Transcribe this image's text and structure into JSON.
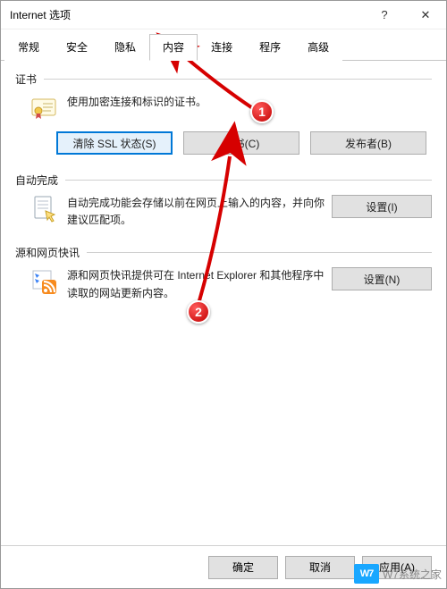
{
  "window": {
    "title": "Internet 选项",
    "help": "?",
    "close": "✕"
  },
  "tabs": [
    {
      "label": "常规"
    },
    {
      "label": "安全"
    },
    {
      "label": "隐私"
    },
    {
      "label": "内容",
      "active": true
    },
    {
      "label": "连接"
    },
    {
      "label": "程序"
    },
    {
      "label": "高级"
    }
  ],
  "groups": {
    "certificates": {
      "title": "证书",
      "desc": "使用加密连接和标识的证书。",
      "buttons": {
        "clear_ssl": "清除 SSL 状态(S)",
        "certificates": "证书(C)",
        "publishers": "发布者(B)"
      }
    },
    "autocomplete": {
      "title": "自动完成",
      "desc": "自动完成功能会存储以前在网页上输入的内容，并向你建议匹配项。",
      "settings": "设置(I)"
    },
    "feeds": {
      "title": "源和网页快讯",
      "desc": "源和网页快讯提供可在 Internet Explorer 和其他程序中读取的网站更新内容。",
      "settings": "设置(N)"
    }
  },
  "footer": {
    "ok": "确定",
    "cancel": "取消",
    "apply": "应用(A)"
  },
  "annotations": {
    "badge1": "1",
    "badge2": "2"
  },
  "watermark": {
    "logo": "W7",
    "text": "W7系统之家"
  }
}
